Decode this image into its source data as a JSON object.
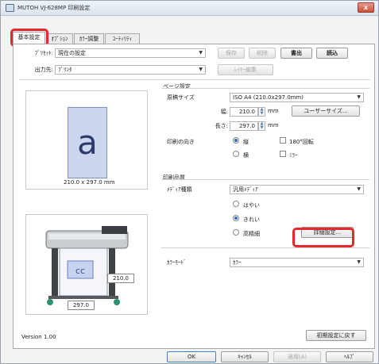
{
  "window": {
    "title": "MUTOH VJ-628MP 印刷設定",
    "icon": "printer-icon",
    "close": "x"
  },
  "tabs": [
    {
      "label": "基本設定",
      "active": true
    },
    {
      "label": "ｵﾌﾟｼｮﾝ"
    },
    {
      "label": "ｶﾗｰ調整"
    },
    {
      "label": "ﾕｰﾃｨﾘﾃｨ"
    }
  ],
  "preset": {
    "label": "ﾌﾟﾘｾｯﾄ:",
    "value": "現在の設定"
  },
  "output": {
    "label": "出力先:",
    "value": "ﾌﾟﾘﾝﾀ"
  },
  "buttons": {
    "save": "保存",
    "delete": "削除",
    "export": "書出",
    "import": "読込",
    "layer_edit": "ﾚｲﾔｰ編集"
  },
  "preview": {
    "letter": "a",
    "size_text": "210.0 x 297.0 mm",
    "width_box": "210.0",
    "height_box": "297.0"
  },
  "page_settings": {
    "group_title": "ページ設定",
    "paper_size_label": "原稿サイズ",
    "paper_size_value": "ISO A4 (210.0x297.0mm)",
    "width_label": "幅:",
    "width_value": "210.0",
    "height_label": "長さ:",
    "height_value": "297.0",
    "unit": "mm",
    "user_size_button": "ユーザーサイズ...",
    "orientation_label": "印刷の向き",
    "portrait": "縦",
    "landscape": "横",
    "rotate180": "180°回転",
    "mirror": "ﾐﾗｰ"
  },
  "print_quality": {
    "group_title": "印刷品質",
    "media_label": "ﾒﾃﾞｨｱ種類",
    "media_value": "汎用ﾒﾃﾞｨｱ",
    "fast": "はやい",
    "fine": "きれい",
    "high_fine": "高精細",
    "detail_button": "詳細設定..."
  },
  "color_mode": {
    "label": "ｶﾗｰﾓｰﾄﾞ",
    "value": "ｶﾗｰ"
  },
  "version": "Version 1.00",
  "reset_button": "初期設定に戻す",
  "footer": {
    "ok": "OK",
    "cancel": "ｷｬﾝｾﾙ",
    "apply": "適用(A)",
    "help": "ﾍﾙﾌﾟ"
  },
  "colors": {
    "highlight": "#e8262b",
    "accent": "#2d6fc4"
  }
}
